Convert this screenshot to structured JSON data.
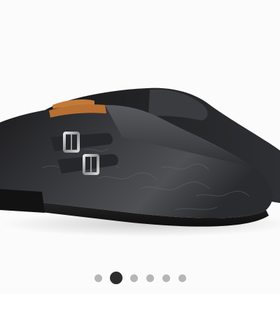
{
  "gallery": {
    "image_icon": "double-monk-strap-shoe-image",
    "slide_count": 6,
    "active_slide": 2
  },
  "colors": {
    "dot_inactive": "#b6b6b6",
    "dot_active": "#2c2c2c",
    "background": "#fbfbfb"
  }
}
